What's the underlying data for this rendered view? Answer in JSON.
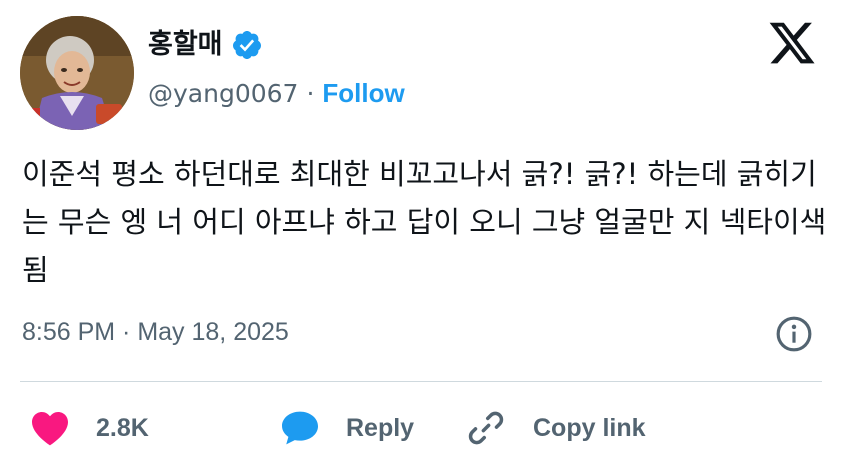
{
  "author": {
    "display_name": "홍할매",
    "handle": "@yang0067",
    "separator": "·",
    "follow_label": "Follow",
    "verified_color": "#1d9bf0",
    "verified": true
  },
  "tweet": {
    "text": "이준석 평소 하던대로 최대한 비꼬고나서 긁?! 긁?! 하는데 긁히기는 무슨 엥 너 어디 아프냐 하고 답이 오니 그냥 얼굴만 지 넥타이색 됨",
    "timestamp": "8:56 PM · May 18, 2025"
  },
  "actions": {
    "like_count": "2.8K",
    "like_color": "#f91880",
    "reply_label": "Reply",
    "reply_color": "#1d9bf0",
    "copy_link_label": "Copy link"
  },
  "icons": {
    "logo": "x-logo-icon",
    "info": "info-icon",
    "like": "heart-icon",
    "reply": "speech-bubble-icon",
    "copy_link": "link-icon"
  }
}
